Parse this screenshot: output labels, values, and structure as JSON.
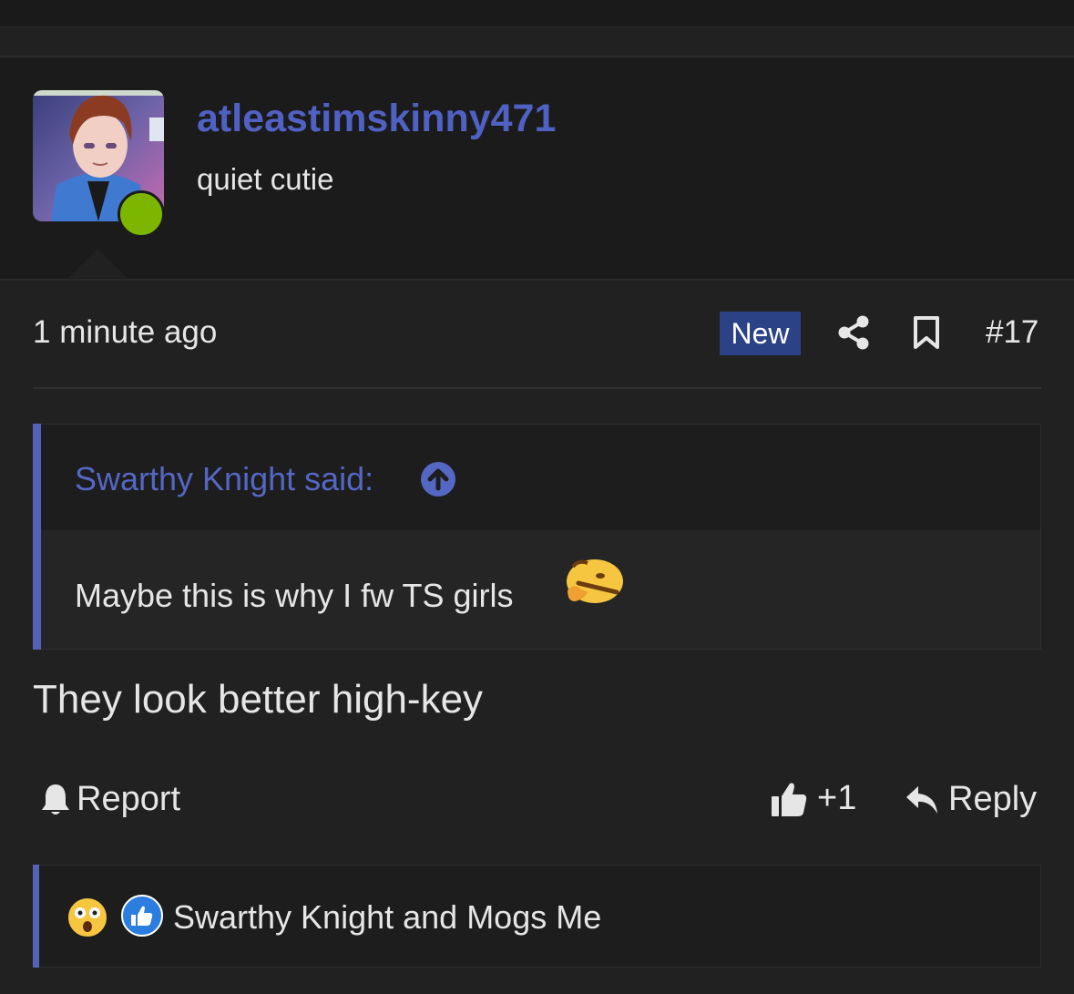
{
  "author": {
    "username": "atleastimskinny471",
    "user_title": "quiet cutie",
    "online": true
  },
  "post": {
    "date": "1 minute ago",
    "badge": "New",
    "number": "#17",
    "quote": {
      "author_line": "Swarthy Knight said:",
      "text": "Maybe this is why I fw TS girls"
    },
    "message": "They look better high-key"
  },
  "actions": {
    "report_label": "Report",
    "like_count": "+1",
    "reply_label": "Reply"
  },
  "reactions": {
    "text": "Swarthy Knight and Mogs Me",
    "icons": [
      "wow-emoji",
      "like-reaction"
    ]
  },
  "colors": {
    "accent": "#5061c4",
    "badge": "#2b4386",
    "online": "#7db600"
  }
}
